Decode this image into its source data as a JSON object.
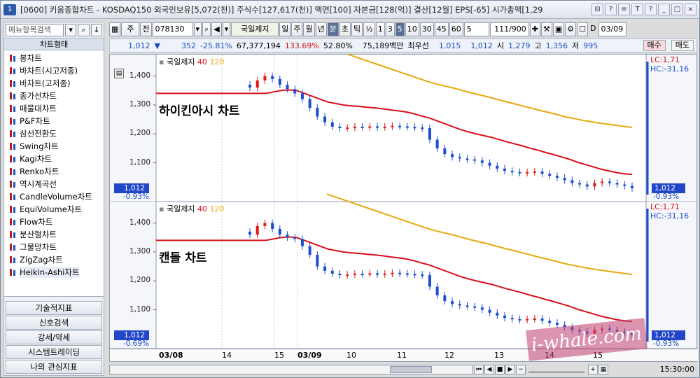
{
  "title": {
    "num": "1",
    "text": "[0600] 키움종합차트 - KOSDAQ150 외국인보유[5,072(천)] 주식수[127,617(천)] 액면[100] 자본금[128(억)] 결산[12월] EPS[-65] 시가총액[1,29",
    "buttons": [
      "⊟",
      "?",
      "≡",
      "T",
      "?",
      "_",
      "□",
      "×"
    ]
  },
  "left": {
    "search_placeholder": "메뉴항목검색",
    "header": "차트형태",
    "items": [
      "봉차트",
      "바차트(시고저종)",
      "바차트(고저종)",
      "종가선차트",
      "매물대차트",
      "P&F차트",
      "삼선전환도",
      "Swing차트",
      "Kagi차트",
      "Renko차트",
      "역시계곡선",
      "CandleVolume차트",
      "EquiVolume차트",
      "Flow차트",
      "분산형차트",
      "그물망차트",
      "ZigZag차트",
      "Heikin-Ashi차트"
    ],
    "bottom": [
      "기술적지표",
      "신호검색",
      "강세/약세",
      "시스템트레이딩",
      "나의 관심지표"
    ]
  },
  "toolbar": {
    "period": "주",
    "prev": "전",
    "code": "078130",
    "name": "국일제지",
    "units": [
      "일",
      "주",
      "월",
      "년",
      "분",
      "초",
      "틱"
    ],
    "ratio": "½",
    "nums": [
      "1",
      "3",
      "5",
      "10",
      "30",
      "45",
      "60"
    ],
    "interval": "5",
    "count": "111/900",
    "date": "03/09",
    "d_label": "D"
  },
  "quote": {
    "price": "1,012",
    "arrow": "▼",
    "change": "352",
    "rate": "-25.81%",
    "volume": "67,377,194",
    "vol_ratio": "133.69%",
    "rate2": "52.80%",
    "amount": "75,189백만",
    "best": "최우선",
    "ask": "1,015",
    "bid": "1,012",
    "open_label": "시",
    "open": "1,279",
    "high_label": "고",
    "high": "1,356",
    "low_label": "저",
    "low": "995",
    "buy": "매수",
    "sell": "매도"
  },
  "charts": [
    {
      "overlay_title": "하이킨아시 차트",
      "legend_name": "국일제지",
      "ma": [
        "40",
        "120"
      ],
      "y_ticks": [
        "1,400",
        "1,300",
        "1,200",
        "1,100"
      ],
      "price": "1,012",
      "pct": "-0.93%",
      "right_top": "LC:1,71",
      "right_hc": "HC:-31,16",
      "right_price": "1,012",
      "right_pct": "-0.93%"
    },
    {
      "overlay_title": "캔들 차트",
      "legend_name": "국일제지",
      "ma": [
        "40",
        "120"
      ],
      "y_ticks": [
        "1,400",
        "1,300",
        "1,200",
        "1,100"
      ],
      "price": "1,012",
      "pct": "-0.69%",
      "right_top": "LC:1,71",
      "right_hc": "HC:-31,16",
      "right_price": "1,012",
      "right_pct": "-0.93%"
    }
  ],
  "xaxis": [
    "03/08",
    "14",
    "15",
    "03/09",
    "10",
    "11",
    "12",
    "13",
    "14",
    "15"
  ],
  "time": "15:30:00",
  "watermark": "i-whale.com",
  "chart_data": [
    {
      "type": "candlestick",
      "title": "하이킨아시 차트",
      "ylim": [
        990,
        1450
      ],
      "series": [
        {
          "name": "국일제지",
          "values": [
            1360,
            1385,
            1400,
            1390,
            1370,
            1355,
            1340,
            1320,
            1290,
            1260,
            1240,
            1225,
            1220,
            1222,
            1225,
            1224,
            1226,
            1223,
            1225,
            1228,
            1226,
            1224,
            1222,
            1220,
            1180,
            1150,
            1130,
            1120,
            1115,
            1112,
            1108,
            1100,
            1090,
            1080,
            1072,
            1068,
            1065,
            1068,
            1070,
            1062,
            1055,
            1048,
            1040,
            1030,
            1025,
            1018,
            1030,
            1035,
            1030,
            1025,
            1020,
            1012
          ]
        },
        {
          "name": "40",
          "values": [
            1340,
            1340,
            1340,
            1345,
            1350,
            1352,
            1350,
            1340,
            1330,
            1320,
            1310,
            1305,
            1300,
            1297,
            1295,
            1292,
            1290,
            1287,
            1283,
            1280,
            1276,
            1270,
            1262,
            1255,
            1245,
            1235,
            1225,
            1215,
            1207,
            1200,
            1194,
            1188,
            1180,
            1172,
            1165,
            1158,
            1150,
            1143,
            1135,
            1128,
            1120,
            1112,
            1102,
            1094,
            1086,
            1078,
            1072,
            1066,
            1062,
            1060
          ]
        },
        {
          "name": "120",
          "values": [
            1500,
            1490,
            1480,
            1470,
            1460,
            1450,
            1440,
            1430,
            1420,
            1410,
            1400,
            1390,
            1380,
            1372,
            1365,
            1358,
            1350,
            1342,
            1335,
            1328,
            1320,
            1312,
            1305,
            1297,
            1290,
            1282,
            1275,
            1268,
            1260,
            1254,
            1248,
            1243,
            1238,
            1234,
            1230,
            1226,
            1222
          ]
        }
      ]
    },
    {
      "type": "candlestick",
      "title": "캔들 차트",
      "ylim": [
        990,
        1450
      ],
      "series": [
        {
          "name": "국일제지",
          "values": [
            1360,
            1390,
            1400,
            1380,
            1360,
            1350,
            1345,
            1320,
            1290,
            1250,
            1235,
            1225,
            1220,
            1222,
            1225,
            1224,
            1226,
            1223,
            1225,
            1228,
            1226,
            1224,
            1222,
            1220,
            1180,
            1150,
            1130,
            1120,
            1115,
            1112,
            1108,
            1100,
            1090,
            1080,
            1072,
            1068,
            1065,
            1068,
            1070,
            1062,
            1055,
            1048,
            1040,
            1030,
            1025,
            1018,
            1030,
            1035,
            1030,
            1025,
            1020,
            1012
          ]
        },
        {
          "name": "40",
          "values": [
            1340,
            1340,
            1340,
            1345,
            1350,
            1352,
            1350,
            1340,
            1330,
            1320,
            1310,
            1305,
            1300,
            1297,
            1295,
            1292,
            1290,
            1287,
            1283,
            1280,
            1276,
            1270,
            1262,
            1255,
            1245,
            1235,
            1225,
            1215,
            1207,
            1200,
            1194,
            1188,
            1180,
            1172,
            1165,
            1158,
            1150,
            1143,
            1135,
            1128,
            1120,
            1112,
            1102,
            1094,
            1086,
            1078,
            1072,
            1066,
            1062,
            1060
          ]
        },
        {
          "name": "120",
          "values": [
            1500,
            1490,
            1480,
            1470,
            1460,
            1450,
            1440,
            1430,
            1420,
            1410,
            1400,
            1390,
            1380,
            1372,
            1365,
            1358,
            1350,
            1342,
            1335,
            1328,
            1320,
            1312,
            1305,
            1297,
            1290,
            1282,
            1275,
            1268,
            1260,
            1254,
            1248,
            1243,
            1238,
            1234,
            1230,
            1226,
            1222
          ]
        }
      ]
    }
  ]
}
